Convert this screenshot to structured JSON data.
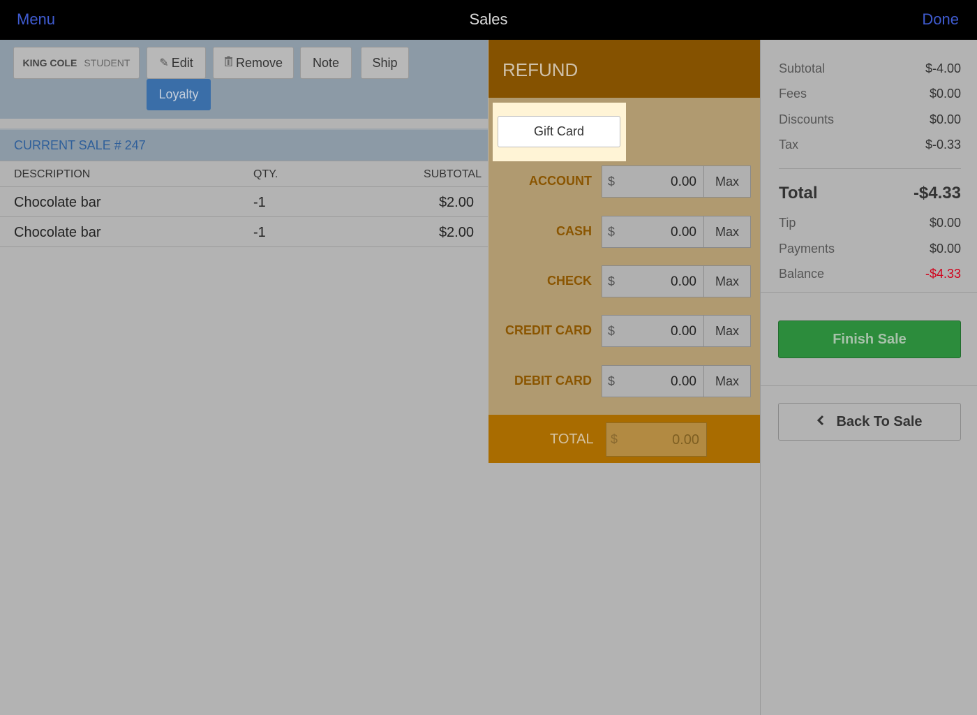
{
  "topbar": {
    "menu": "Menu",
    "title": "Sales",
    "done": "Done"
  },
  "customer": {
    "name": "KING COLE",
    "type": "STUDENT"
  },
  "toolbar": {
    "edit": "Edit",
    "remove": "Remove",
    "note": "Note",
    "ship": "Ship",
    "loyalty": "Loyalty"
  },
  "sale": {
    "header": "CURRENT SALE # 247",
    "columns": {
      "description": "DESCRIPTION",
      "qty": "QTY.",
      "subtotal": "SUBTOTAL"
    },
    "items": [
      {
        "description": "Chocolate bar",
        "qty": "-1",
        "subtotal": "$2.00"
      },
      {
        "description": "Chocolate bar",
        "qty": "-1",
        "subtotal": "$2.00"
      }
    ]
  },
  "refund": {
    "title": "REFUND",
    "gift_card": "Gift Card",
    "currency": "$",
    "max": "Max",
    "methods": [
      {
        "label": "ACCOUNT",
        "amount": "0.00"
      },
      {
        "label": "CASH",
        "amount": "0.00"
      },
      {
        "label": "CHECK",
        "amount": "0.00"
      },
      {
        "label": "CREDIT CARD",
        "amount": "0.00"
      },
      {
        "label": "DEBIT CARD",
        "amount": "0.00"
      }
    ],
    "total_label": "TOTAL",
    "total_amount": "0.00"
  },
  "summary": {
    "subtotal": {
      "label": "Subtotal",
      "value": "$-4.00"
    },
    "fees": {
      "label": "Fees",
      "value": "$0.00"
    },
    "discounts": {
      "label": "Discounts",
      "value": "$0.00"
    },
    "tax": {
      "label": "Tax",
      "value": "$-0.33"
    },
    "total": {
      "label": "Total",
      "value": "-$4.33"
    },
    "tip": {
      "label": "Tip",
      "value": "$0.00"
    },
    "payments": {
      "label": "Payments",
      "value": "$0.00"
    },
    "balance": {
      "label": "Balance",
      "value": "-$4.33"
    },
    "balance_color": "#d0021b"
  },
  "actions": {
    "finish": "Finish Sale",
    "back": "Back To Sale"
  },
  "colors": {
    "accent": "#3f5bd0",
    "refund_header": "#855200",
    "finish_green": "#2c8c3c",
    "loyalty_blue": "#3a6ea8"
  }
}
